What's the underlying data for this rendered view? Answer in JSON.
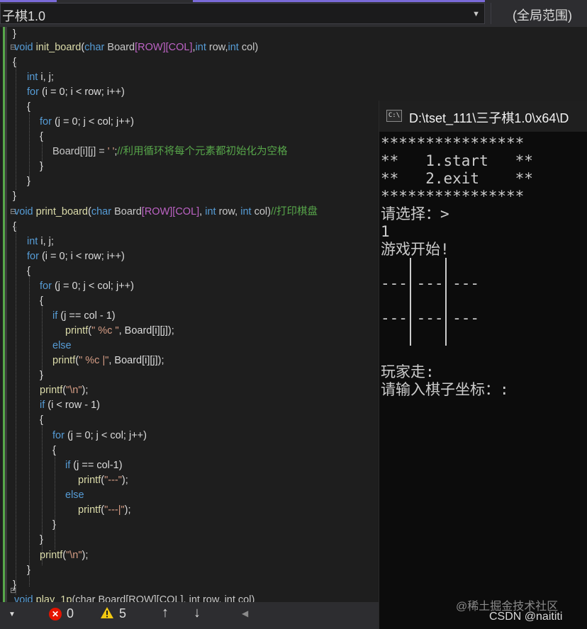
{
  "toolbar": {
    "project": "子棋1.0",
    "scope": "(全局范围)"
  },
  "console": {
    "title": "D:\\tset_111\\三子棋1.0\\x64\\D",
    "icon_text": "C:\\",
    "menu_top": "****************",
    "menu_start": "**   1.start   **",
    "menu_exit": "**   2.exit    **",
    "menu_bottom": "****************",
    "prompt_choose": "请选择：>",
    "input_value": "1",
    "game_start": "游戏开始!",
    "row1": "--- --- ---",
    "row2": "--- --- ---",
    "player_turn": "玩家走:",
    "enter_coords": "请输入棋子坐标：:"
  },
  "watermark": {
    "juejin": "@稀土掘金技术社区",
    "csdn": "CSDN @naititi"
  },
  "status": {
    "errors": "0",
    "warnings": "5",
    "error_icon": "x-circle-icon",
    "warning_icon": "warning-triangle-icon"
  },
  "code": {
    "l01": "}",
    "l02_k": "void",
    "l02_f": "init_board",
    "l02_a": "(",
    "l02_b": "char",
    "l02_c": " Board",
    "l02_d": "[ROW][COL]",
    "l02_e": ",",
    "l02_g": "int",
    "l02_h": " row,",
    "l02_i": "int",
    "l02_j": " col)",
    "l03": "{",
    "l04_k": "int",
    "l04_t": " i, j;",
    "l05_k": "for",
    "l05_t": " (i = 0; i < row; i++)",
    "l06": "{",
    "l07_k": "for",
    "l07_t": " (j = 0; j < col; j++)",
    "l08": "{",
    "l09_t": "Board[i][j] = ",
    "l09_s": "' '",
    "l09_p": ";",
    "l09_c": "//利用循环将每个元素都初始化为空格",
    "l10": "}",
    "l11": "}",
    "l12": "}",
    "l13_k": "void",
    "l13_f": "print_board",
    "l13_a": "(",
    "l13_b": "char",
    "l13_c": " Board",
    "l13_d": "[ROW][COL]",
    "l13_e": ", ",
    "l13_g": "int",
    "l13_h": " row, ",
    "l13_i": "int",
    "l13_j": " col)",
    "l13_cm": "//打印棋盘",
    "l14": "{",
    "l15_k": "int",
    "l15_t": " i, j;",
    "l16_k": "for",
    "l16_t": " (i = 0; i < row; i++)",
    "l17": "{",
    "l18_k": "for",
    "l18_t": " (j = 0; j < col; j++)",
    "l19": "{",
    "l20_k": "if",
    "l20_t": " (j == col - 1)",
    "l21_f": "printf",
    "l21_a": "(",
    "l21_s": "\" %c \"",
    "l21_t": ", Board[i][j]);",
    "l22_k": "else",
    "l23_f": "printf",
    "l23_a": "(",
    "l23_s": "\" %c |\"",
    "l23_t": ", Board[i][j]);",
    "l24": "}",
    "l25_f": "printf",
    "l25_a": "(",
    "l25_s": "\"\\n\"",
    "l25_t": ");",
    "l26_k": "if",
    "l26_t": " (i < row - 1)",
    "l27": "{",
    "l28_k": "for",
    "l28_t": " (j = 0; j < col; j++)",
    "l29": "{",
    "l30_k": "if",
    "l30_t": " (j == col-1)",
    "l31_f": "printf",
    "l31_a": "(",
    "l31_s": "\"---\"",
    "l31_t": ");",
    "l32_k": "else",
    "l33_f": "printf",
    "l33_a": "(",
    "l33_s": "\"---|\"",
    "l33_t": ");",
    "l34": "}",
    "l35": "}",
    "l36_f": "printf",
    "l36_a": "(",
    "l36_s": "\"\\n\"",
    "l36_t": ");",
    "l37": "}",
    "l38": "}",
    "l39_k": "void",
    "l39_f": "play_1p",
    "l39_t": "(char Board[ROW][COL], int row, int col)"
  }
}
